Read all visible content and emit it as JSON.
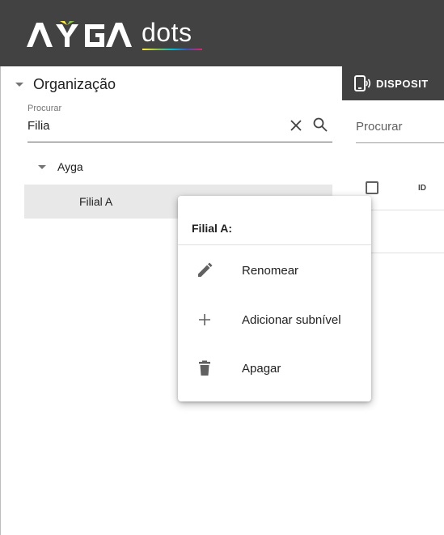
{
  "header": {
    "logo_text": "AYGA",
    "logo_suffix": "dots"
  },
  "organization_panel": {
    "title": "Organização",
    "search": {
      "label": "Procurar",
      "value": "Filia"
    },
    "tree": {
      "root": {
        "label": "Ayga",
        "expanded": true
      },
      "child": {
        "label": "Filial A",
        "selected": true
      }
    }
  },
  "devices_panel": {
    "tab_label": "DISPOSIT",
    "search_placeholder": "Procurar",
    "columns": [
      "ID"
    ]
  },
  "context_menu": {
    "title": "Filial A:",
    "items": [
      {
        "label": "Renomear",
        "icon": "pencil-icon"
      },
      {
        "label": "Adicionar subnível",
        "icon": "plus-icon"
      },
      {
        "label": "Apagar",
        "icon": "trash-icon"
      }
    ]
  },
  "colors": {
    "header_bg": "#424242",
    "selected_row_bg": "#e8e8e8"
  }
}
